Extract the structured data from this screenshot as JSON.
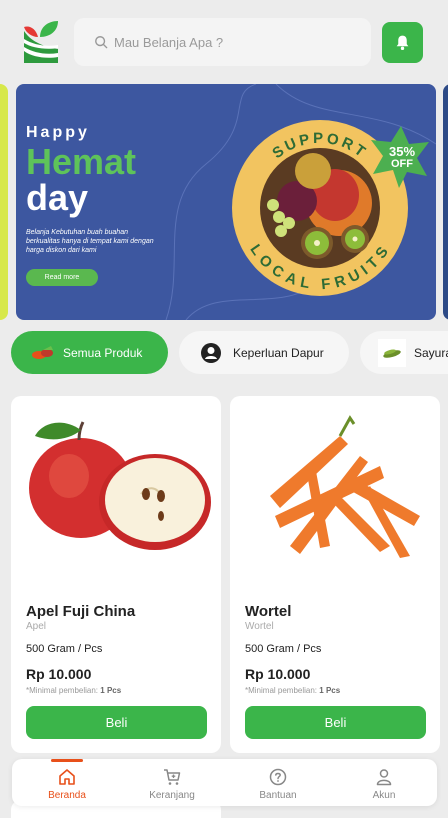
{
  "header": {
    "search_placeholder": "Mau Belanja Apa ?"
  },
  "banner": {
    "happy": "Happy",
    "hemat": "Hemat",
    "day": "day",
    "description": "Belanja Kebutuhan buah buahan berkualitas hanya di tempat kami dengan harga diskon dari kami",
    "read_more": "Read more",
    "badge_top": "SUPPORT",
    "badge_bottom": "LOCAL FRUITS",
    "discount_value": "35%",
    "discount_label": "OFF"
  },
  "categories": [
    {
      "label": "Semua Produk",
      "active": true
    },
    {
      "label": "Keperluan Dapur",
      "active": false
    },
    {
      "label": "Sayuran",
      "active": false
    }
  ],
  "products": [
    {
      "name": "Apel Fuji China",
      "category": "Apel",
      "weight": "500 Gram / Pcs",
      "price": "Rp 10.000",
      "min_label": "*Minimal pembelian: ",
      "min_value": "1 Pcs",
      "button": "Beli"
    },
    {
      "name": "Wortel",
      "category": "Wortel",
      "weight": "500 Gram / Pcs",
      "price": "Rp 10.000",
      "min_label": "*Minimal pembelian: ",
      "min_value": "1 Pcs",
      "button": "Beli"
    }
  ],
  "nav": [
    {
      "label": "Beranda",
      "icon": "home-icon",
      "active": true
    },
    {
      "label": "Keranjang",
      "icon": "cart-icon",
      "active": false
    },
    {
      "label": "Bantuan",
      "icon": "help-icon",
      "active": false
    },
    {
      "label": "Akun",
      "icon": "user-icon",
      "active": false
    }
  ],
  "colors": {
    "primary_green": "#3bb54a",
    "banner_blue": "#3d57a0",
    "active_nav": "#e8501a"
  }
}
